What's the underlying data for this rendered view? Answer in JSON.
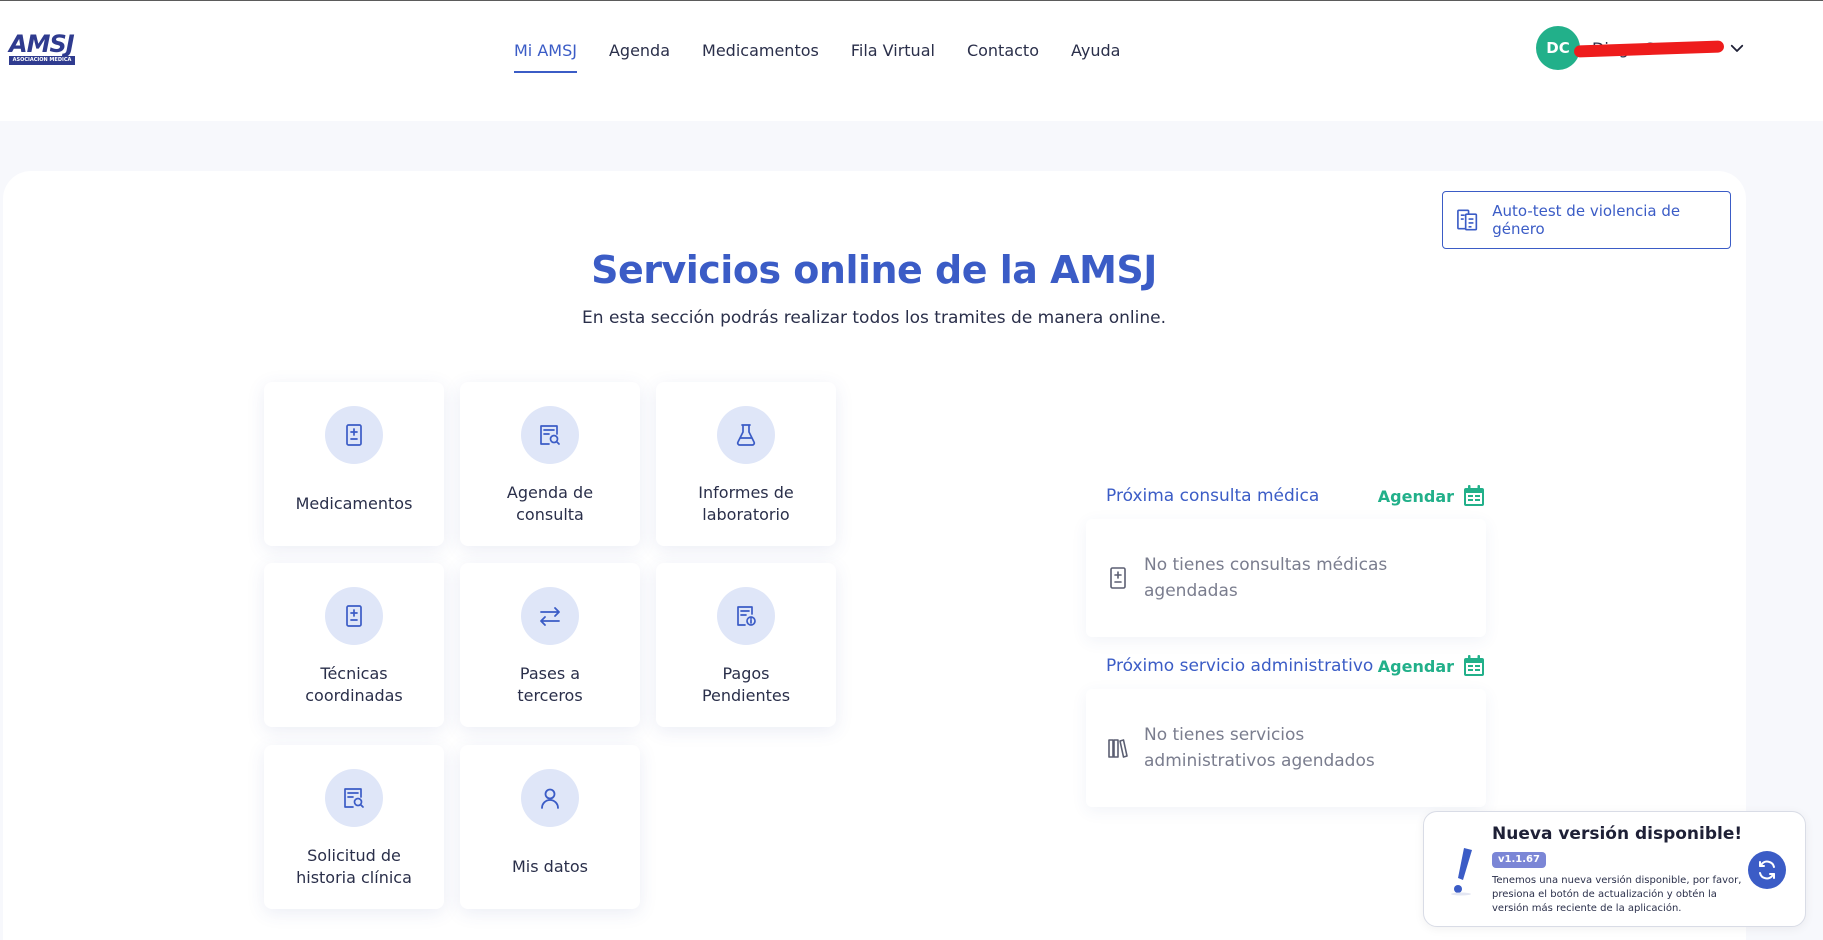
{
  "header": {
    "logo": {
      "word": "AMSJ",
      "tagline": "ASOCIACION MEDICA"
    },
    "nav": [
      {
        "label": "Mi AMSJ",
        "active": true
      },
      {
        "label": "Agenda"
      },
      {
        "label": "Medicamentos"
      },
      {
        "label": "Fila Virtual"
      },
      {
        "label": "Contacto"
      },
      {
        "label": "Ayuda"
      }
    ],
    "user": {
      "initials": "DC",
      "name": "Diego C"
    }
  },
  "main": {
    "autotest_label": "Auto-test de violencia de género",
    "title": "Servicios online de la AMSJ",
    "subtitle": "En esta sección podrás realizar todos los tramites de manera online.",
    "tiles": [
      {
        "line1": "Medicamentos",
        "line2": "",
        "icon": "prescription-icon"
      },
      {
        "line1": "Agenda de",
        "line2": "consulta",
        "icon": "document-search-icon"
      },
      {
        "line1": "Informes de",
        "line2": "laboratorio",
        "icon": "flask-icon"
      },
      {
        "line1": "Técnicas",
        "line2": "coordinadas",
        "icon": "prescription-icon"
      },
      {
        "line1": "Pases a",
        "line2": "terceros",
        "icon": "transfer-arrows-icon"
      },
      {
        "line1": "Pagos",
        "line2": "Pendientes",
        "icon": "document-info-icon"
      },
      {
        "line1": "Solicitud de",
        "line2": "historia clínica",
        "icon": "document-search-icon"
      },
      {
        "line1": "Mis datos",
        "line2": "",
        "icon": "user-icon"
      }
    ],
    "next_consult": {
      "title": "Próxima consulta médica",
      "action": "Agendar",
      "empty": "No tienes consultas médicas agendadas"
    },
    "next_admin": {
      "title": "Próximo servicio administrativo",
      "action": "Agendar",
      "empty": "No tienes servicios administrativos agendados"
    }
  },
  "toast": {
    "title": "Nueva versión disponible!",
    "version": "v1.1.67",
    "body": "Tenemos una nueva versión disponible, por favor, presiona el botón de actualización y obtén la versión más reciente de la aplicación."
  },
  "colors": {
    "primary": "#3b5cc6",
    "accent_green": "#22b08a",
    "icon_bg": "#dfe6f8"
  }
}
